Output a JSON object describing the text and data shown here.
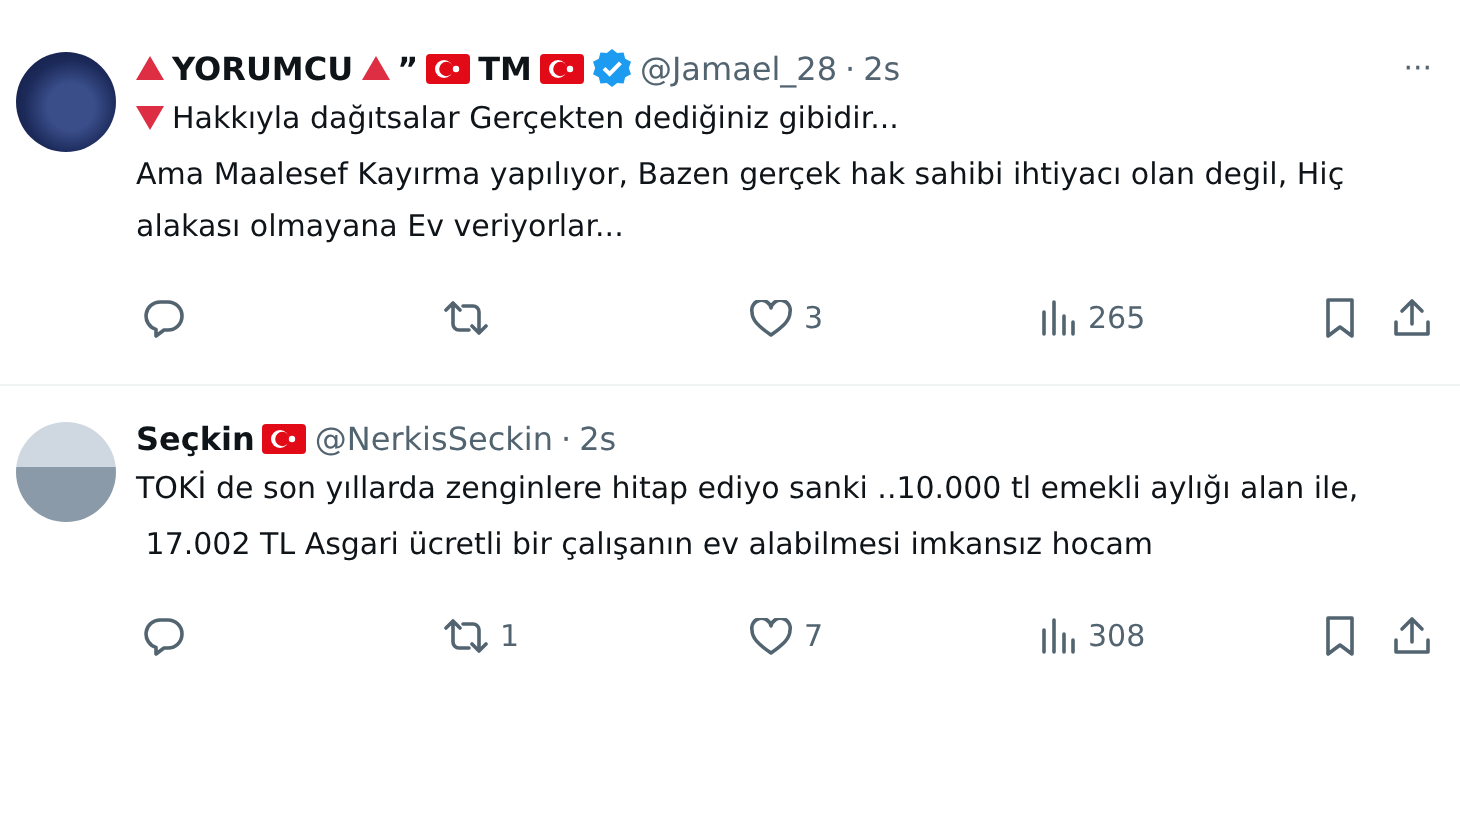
{
  "tweets": [
    {
      "name_parts": [
        {
          "kind": "triangle"
        },
        {
          "kind": "text",
          "text": "YORUMCU"
        },
        {
          "kind": "triangle"
        },
        {
          "kind": "text",
          "text": "”"
        },
        {
          "kind": "flag"
        },
        {
          "kind": "text",
          "text": "TM"
        },
        {
          "kind": "flag"
        }
      ],
      "verified": true,
      "handle": "@Jamael_28",
      "separator": "·",
      "time": "2s",
      "more": "···",
      "paragraphs": [
        {
          "kind": "triangle-lead",
          "text": "Hakkıyla dağıtsalar Gerçekten dediğiniz gibidir..."
        },
        {
          "kind": "plain",
          "text": "Ama Maalesef Kayırma yapılıyor, Bazen gerçek hak sahibi ihtiyacı olan degil, Hiç alakası olmayana Ev veriyorlar..."
        }
      ],
      "likes": "3",
      "views": "265"
    },
    {
      "name_parts": [
        {
          "kind": "text",
          "text": "Seçkin"
        },
        {
          "kind": "flag"
        }
      ],
      "verified": false,
      "handle": "@NerkisSeckin",
      "separator": "·",
      "time": "2s",
      "paragraphs": [
        {
          "kind": "plain",
          "text": "TOKİ de son yıllarda zenginlere hitap ediyo sanki ..10.000 tl emekli aylığı alan ile,"
        },
        {
          "kind": "plain",
          "text": " 17.002 TL Asgari ücretli bir çalışanın ev alabilmesi imkansız hocam"
        }
      ],
      "retweets": "1",
      "likes": "7",
      "views": "308"
    }
  ]
}
